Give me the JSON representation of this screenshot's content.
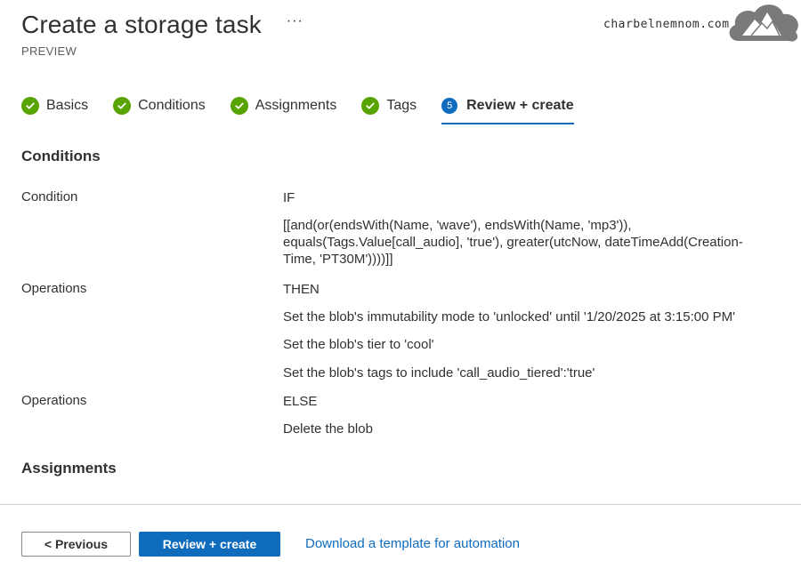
{
  "header": {
    "title": "Create a storage task",
    "more": "···",
    "subtitle": "PREVIEW"
  },
  "brand": {
    "text": "charbelnemnom.com"
  },
  "wizard": {
    "steps": [
      {
        "label": "Basics",
        "status": "complete"
      },
      {
        "label": "Conditions",
        "status": "complete"
      },
      {
        "label": "Assignments",
        "status": "complete"
      },
      {
        "label": "Tags",
        "status": "complete"
      },
      {
        "label": "Review + create",
        "status": "active",
        "number": "5"
      }
    ]
  },
  "conditions": {
    "section_title": "Conditions",
    "condition_label": "Condition",
    "if_keyword": "IF",
    "expression_lines": [
      "[[and(or(endsWith(Name, 'wave'), endsWith(Name, 'mp3')),",
      "equals(Tags.Value[call_audio], 'true'), greater(utcNow, dateTimeAdd(Creation-",
      "Time, 'PT30M'))))]]"
    ],
    "operations_label": "Operations",
    "then_keyword": "THEN",
    "then_ops": [
      "Set the blob's immutability mode to 'unlocked' until '1/20/2025 at 3:15:00 PM'",
      "Set the blob's tier to 'cool'",
      "Set the blob's tags to include 'call_audio_tiered':'true'"
    ],
    "operations_label_2": "Operations",
    "else_keyword": "ELSE",
    "else_ops": [
      "Delete the blob"
    ]
  },
  "assignments": {
    "section_title": "Assignments"
  },
  "footer": {
    "previous_label": "< Previous",
    "create_label": "Review + create",
    "download_link": "Download a template for automation"
  },
  "colors": {
    "accent": "#0f6cbd",
    "success": "#57a300",
    "text": "#323130"
  },
  "icons": {
    "step_complete": "check-circle-icon",
    "brand_logo": "mountain-cloud-icon"
  }
}
